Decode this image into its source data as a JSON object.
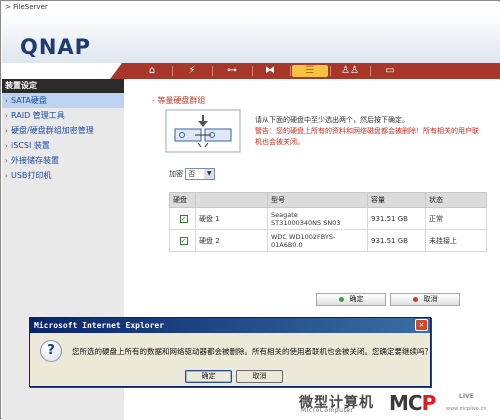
{
  "window": {
    "title": "FileServer"
  },
  "brand": {
    "logo_text": "QNAP"
  },
  "nav": {
    "icons": [
      {
        "name": "home-icon",
        "glyph": "⌂"
      },
      {
        "name": "lightning-icon",
        "glyph": "⚡"
      },
      {
        "name": "connector-icon",
        "glyph": "⊶"
      },
      {
        "name": "plug-icon",
        "glyph": "⧓"
      },
      {
        "name": "disk-icon",
        "glyph": "☰"
      },
      {
        "name": "users-icon",
        "glyph": "♙♙"
      },
      {
        "name": "folder-icon",
        "glyph": "▭"
      }
    ]
  },
  "sidebar": {
    "header": "装置设定",
    "items": [
      {
        "label": "SATA硬盘"
      },
      {
        "label": "RAID 管理工具"
      },
      {
        "label": "硬盘/硬盘群组加密管理"
      },
      {
        "label": "iSCSI 装置"
      },
      {
        "label": "外接储存装置"
      },
      {
        "label": "USB打印机"
      }
    ]
  },
  "main": {
    "section_title": "- 等量硬盘群组",
    "instruction": "请从下面的硬盘中至少选出两个，然后按下确定。",
    "warning": "警告：您的硬盘上所有的资料和网络磁盘都会被删除！所有相关的用户联机也会被关闭。",
    "encrypt_label": "加密",
    "encrypt_value": "否",
    "table": {
      "headers": [
        "硬盘",
        "",
        "型号",
        "容量",
        "状态"
      ],
      "rows": [
        {
          "disk": "硬盘 1",
          "model_line1": "Seagate",
          "model_line2": "ST31000340NS SN03",
          "capacity": "931.51 GB",
          "status": "正常"
        },
        {
          "disk": "硬盘 2",
          "model_line1": "WDC WD1002FBYS-",
          "model_line2": "01A6B0.0",
          "capacity": "931.51 GB",
          "status": "未挂接上"
        }
      ]
    },
    "ok_label": "确定",
    "cancel_label": "取消"
  },
  "dialog": {
    "title": "Microsoft Internet Explorer",
    "message": "您所选的硬盘上所有的数据和网络驱动器都会被删除。所有相关的使用者联机也会被关闭。您确定要继续吗？",
    "ok_label": "确定",
    "cancel_label": "取消"
  },
  "watermark": {
    "cn": "微型计算机",
    "en": "MicroComputer",
    "logo": "MC",
    "logo_accent": "P",
    "live": "LIVE",
    "url": "www.mcplive.cn"
  },
  "colors": {
    "nav_red": "#a8372b",
    "nav_active": "#f5c242",
    "warning_red": "#d42a1c",
    "dialog_title": "#0a246a"
  }
}
